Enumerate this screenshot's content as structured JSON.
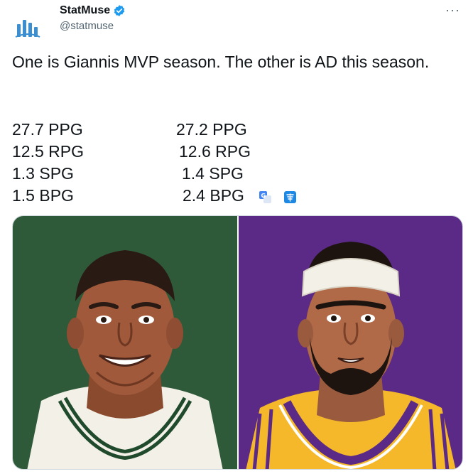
{
  "account": {
    "display_name": "StatMuse",
    "handle": "@statmuse",
    "verified": true
  },
  "tweet": {
    "text": "One is Giannis MVP season. The other is AD this season.",
    "stats": [
      {
        "left": "27.7 PPG",
        "right": "27.2 PPG"
      },
      {
        "left": "12.5 RPG",
        "right": "12.6 RPG"
      },
      {
        "left": "1.3 SPG",
        "right": "1.4 SPG"
      },
      {
        "left": "1.5 BPG",
        "right": "2.4 BPG"
      }
    ]
  },
  "icons": {
    "more": "more-options-icon",
    "verified": "verified-badge-icon",
    "translate_google": "google-translate-icon",
    "translate_cn": "translate-icon"
  },
  "colors": {
    "accent_blue": "#1d9bf0",
    "bucks_green": "#2f5a3a",
    "lakers_purple": "#5b2a86",
    "lakers_gold": "#f4b82a"
  },
  "more_label": "···"
}
